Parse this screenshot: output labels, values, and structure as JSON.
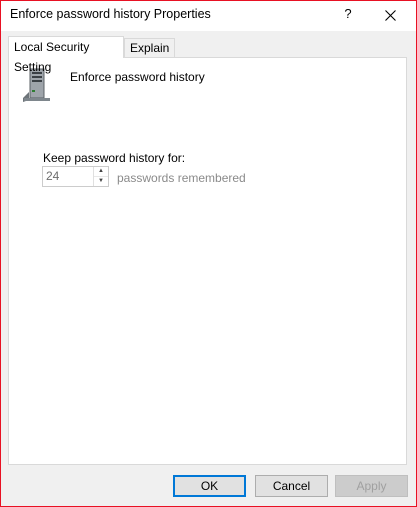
{
  "window": {
    "title": "Enforce password history Properties",
    "help_glyph": "?",
    "close_icon": "close-icon",
    "accent_border": "#e81123"
  },
  "tabs": [
    {
      "label": "Local Security Setting",
      "active": true
    },
    {
      "label": "Explain",
      "active": false
    }
  ],
  "panel": {
    "icon": "server-icon",
    "policy_name": "Enforce password history",
    "keep_label": "Keep password history for:",
    "spinner": {
      "value": "24",
      "disabled": true
    },
    "units_label": "passwords remembered"
  },
  "buttons": {
    "ok": "OK",
    "cancel": "Cancel",
    "apply": "Apply"
  }
}
